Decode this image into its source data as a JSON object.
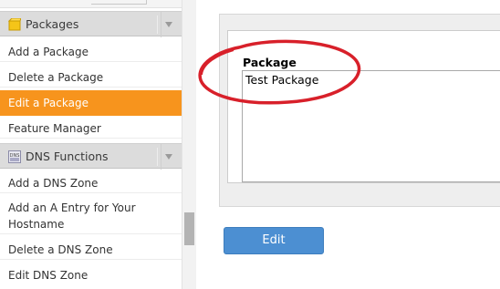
{
  "sidebar": {
    "sections": [
      {
        "title": "Packages",
        "icon": "package-icon",
        "items": [
          "Add a Package",
          "Delete a Package",
          "Edit a Package",
          "Feature Manager"
        ],
        "active_item": "Edit a Package"
      },
      {
        "title": "DNS Functions",
        "icon": "dns-icon",
        "icon_text": "DNS",
        "items": [
          "Add a DNS Zone",
          "Add an A Entry for Your Hostname",
          "Delete a DNS Zone",
          "Edit DNS Zone"
        ]
      }
    ]
  },
  "form": {
    "field_label": "Package",
    "selected_option": "Test Package",
    "submit_label": "Edit"
  },
  "colors": {
    "active_item": "#f7941d",
    "button": "#4c8fd2",
    "annotation": "#d8202a"
  }
}
